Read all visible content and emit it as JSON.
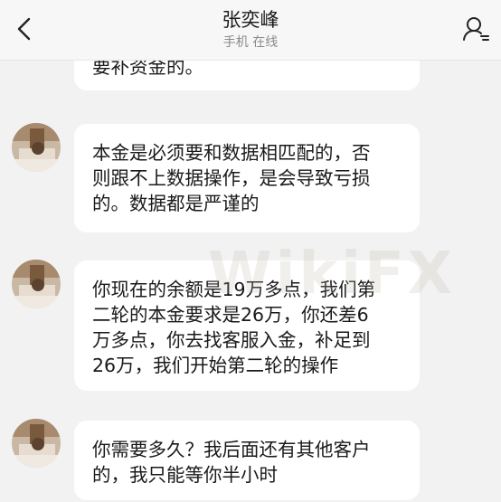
{
  "header": {
    "title": "张奕峰",
    "subtitle": "手机 在线",
    "back_icon": "chevron-left-icon",
    "profile_icon": "contact-profile-icon"
  },
  "watermark": "WikiFX",
  "messages": [
    {
      "text": "要补资金的。",
      "partial": true
    },
    {
      "text": "本金是必须要和数据相匹配的，否\n则跟不上数据操作，是会导致亏损\n的。数据都是严谨的"
    },
    {
      "text": "你现在的余额是19万多点，我们第\n二轮的本金要求是26万，你还差6\n万多点，你去找客服入金，补足到\n26万，我们开始第二轮的操作"
    },
    {
      "text": "你需要多久？我后面还有其他客户\n的，我只能等你半小时"
    }
  ]
}
